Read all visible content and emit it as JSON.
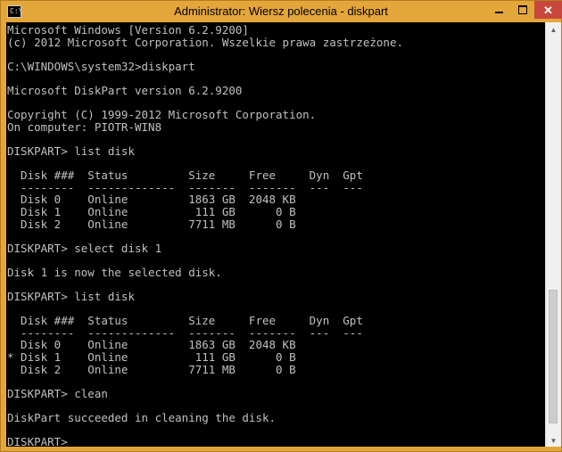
{
  "window": {
    "title": "Administrator: Wiersz polecenia - diskpart",
    "icon": "cmd-icon",
    "controls": {
      "minimize": "minimize-icon",
      "maximize": "maximize-icon",
      "close": "close-icon"
    },
    "accent_color": "#e3a63b",
    "close_color": "#c7473c"
  },
  "console": {
    "background": "#000000",
    "foreground": "#c0c0c0",
    "lines": [
      "Microsoft Windows [Version 6.2.9200]",
      "(c) 2012 Microsoft Corporation. Wszelkie prawa zastrzeżone.",
      "",
      "C:\\WINDOWS\\system32>diskpart",
      "",
      "Microsoft DiskPart version 6.2.9200",
      "",
      "Copyright (C) 1999-2012 Microsoft Corporation.",
      "On computer: PIOTR-WIN8",
      "",
      "DISKPART> list disk",
      "",
      "  Disk ###  Status         Size     Free     Dyn  Gpt",
      "  --------  -------------  -------  -------  ---  ---",
      "  Disk 0    Online         1863 GB  2048 KB",
      "  Disk 1    Online          111 GB      0 B",
      "  Disk 2    Online         7711 MB      0 B",
      "",
      "DISKPART> select disk 1",
      "",
      "Disk 1 is now the selected disk.",
      "",
      "DISKPART> list disk",
      "",
      "  Disk ###  Status         Size     Free     Dyn  Gpt",
      "  --------  -------------  -------  -------  ---  ---",
      "  Disk 0    Online         1863 GB  2048 KB",
      "* Disk 1    Online          111 GB      0 B",
      "  Disk 2    Online         7711 MB      0 B",
      "",
      "DISKPART> clean",
      "",
      "DiskPart succeeded in cleaning the disk.",
      "",
      "DISKPART>"
    ]
  }
}
